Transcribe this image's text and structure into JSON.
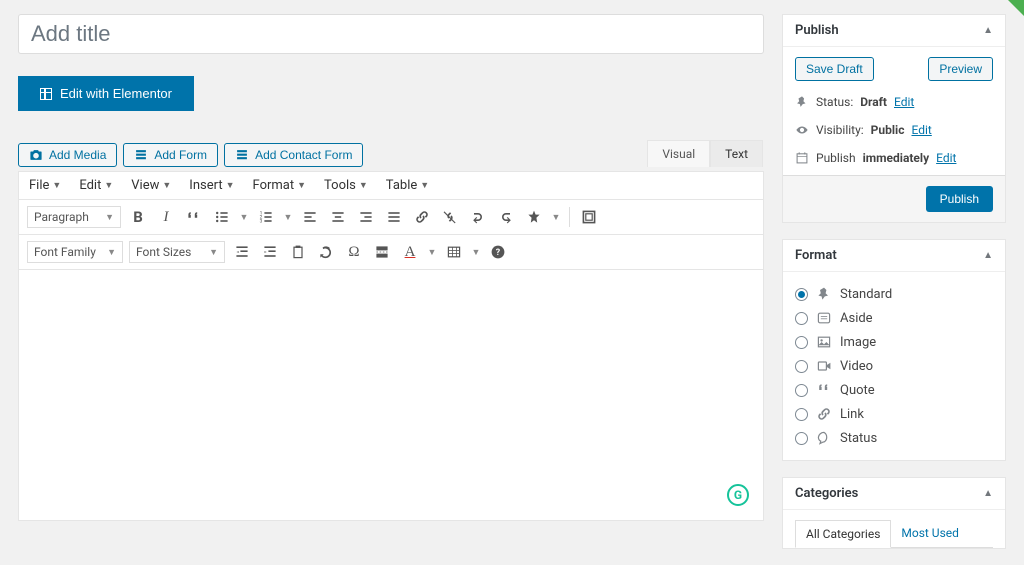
{
  "title": {
    "placeholder": "Add title"
  },
  "elementor": {
    "label": "Edit with Elementor"
  },
  "media_buttons": {
    "add_media": "Add Media",
    "add_form": "Add Form",
    "add_contact_form": "Add Contact Form"
  },
  "editor_tabs": {
    "visual": "Visual",
    "text": "Text"
  },
  "menubar": {
    "file": "File",
    "edit": "Edit",
    "view": "View",
    "insert": "Insert",
    "format": "Format",
    "tools": "Tools",
    "table": "Table"
  },
  "toolbar": {
    "paragraph": "Paragraph",
    "font_family": "Font Family",
    "font_sizes": "Font Sizes"
  },
  "publish": {
    "title": "Publish",
    "save_draft": "Save Draft",
    "preview": "Preview",
    "status_label": "Status:",
    "status_value": "Draft",
    "visibility_label": "Visibility:",
    "visibility_value": "Public",
    "schedule_label": "Publish",
    "schedule_value": "immediately",
    "edit": "Edit",
    "publish_btn": "Publish"
  },
  "format": {
    "title": "Format",
    "options": {
      "standard": "Standard",
      "aside": "Aside",
      "image": "Image",
      "video": "Video",
      "quote": "Quote",
      "link": "Link",
      "status": "Status"
    }
  },
  "categories": {
    "title": "Categories",
    "tabs": {
      "all": "All Categories",
      "most_used": "Most Used"
    }
  },
  "grammarly": "G"
}
